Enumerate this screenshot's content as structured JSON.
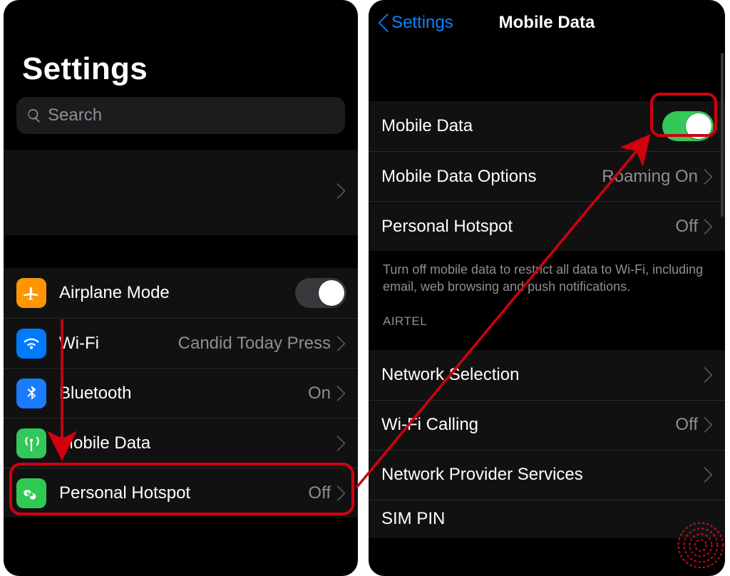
{
  "left": {
    "title": "Settings",
    "search_placeholder": "Search",
    "rows": {
      "airplane": {
        "label": "Airplane Mode"
      },
      "wifi": {
        "label": "Wi-Fi",
        "value": "Candid Today Press"
      },
      "bluetooth": {
        "label": "Bluetooth",
        "value": "On"
      },
      "mobile_data": {
        "label": "Mobile Data"
      },
      "hotspot": {
        "label": "Personal Hotspot",
        "value": "Off"
      }
    }
  },
  "right": {
    "back_label": "Settings",
    "title": "Mobile Data",
    "rows": {
      "mobile_data": {
        "label": "Mobile Data",
        "toggle_on": true
      },
      "options": {
        "label": "Mobile Data Options",
        "value": "Roaming On"
      },
      "hotspot": {
        "label": "Personal Hotspot",
        "value": "Off"
      }
    },
    "footnote": "Turn off mobile data to restrict all data to Wi-Fi, including email, web browsing and push notifications.",
    "carrier_header": "AIRTEL",
    "carrier_rows": {
      "network_selection": {
        "label": "Network Selection"
      },
      "wifi_calling": {
        "label": "Wi-Fi Calling",
        "value": "Off"
      },
      "provider_services": {
        "label": "Network Provider Services"
      },
      "sim_pin": {
        "label": "SIM PIN"
      }
    }
  },
  "colors": {
    "accent_blue": "#0a84ff",
    "toggle_green": "#34c759",
    "highlight_red": "#d2000f"
  }
}
